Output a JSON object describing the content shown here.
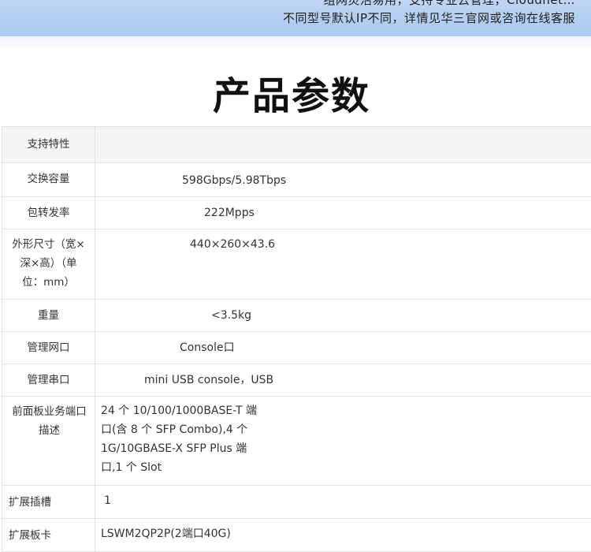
{
  "banner": {
    "line1": "组网灵活易用，支持专业云管理，Cloudnet…",
    "line2": "不同型号默认IP不同，详情见华三官网或咨询在线客服"
  },
  "section_title": "产品参数",
  "specs": [
    {
      "label": "支持特性",
      "value": ""
    },
    {
      "label": "交换容量",
      "value": "598Gbps/5.98Tbps"
    },
    {
      "label": "包转发率",
      "value": "222Mpps"
    },
    {
      "label": "外形尺寸（宽×深×高）（单位：mm）",
      "value": "440×260×43.6"
    },
    {
      "label": "重量",
      "value": "<3.5kg"
    },
    {
      "label": "管理网口",
      "value": "Console口"
    },
    {
      "label": "管理串口",
      "value": "mini USB console，USB"
    },
    {
      "label": "前面板业务端口描述",
      "value": "24 个 10/100/1000BASE-T 端口(含 8 个 SFP Combo),4 个 1G/10GBASE-X SFP Plus 端口,1 个 Slot"
    },
    {
      "label": "扩展插槽",
      "value": "1"
    },
    {
      "label": "扩展板卡",
      "value": "LSWM2QP2P(2端口40G)"
    }
  ]
}
